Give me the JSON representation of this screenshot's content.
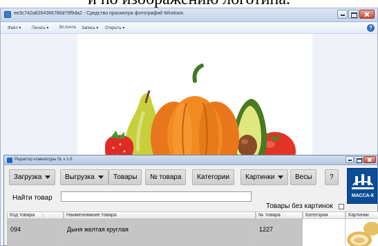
{
  "caption": {
    "text": "и по изображению логотипа."
  },
  "photo_viewer": {
    "title": "ee3c742a8264366786d79f9da2 - Средство просмотра фотографий Windows",
    "menu": [
      "Файл ▾",
      "Печать ▾",
      "Эл.почта",
      "Запись ▾",
      "Открыть ▾"
    ],
    "help_icon": "help-icon"
  },
  "keyboard_editor": {
    "title": "Редактор клавиатуры SL v 1.6",
    "toolbar": {
      "load_label": "Загрузка",
      "unload_label": "Выгрузка",
      "products_label": "Товары",
      "product_no_label": "№ товара",
      "categories_label": "Категории",
      "images_label": "Картинки",
      "scales_label": "Весы",
      "help_label": "?"
    },
    "logo_text": "МАССА-К",
    "search": {
      "label": "Найти товар",
      "value": "",
      "placeholder": ""
    },
    "no_images_label": "Товары без картинок",
    "no_images_checked": false,
    "table": {
      "columns": [
        "Код товара",
        "Наименование товара",
        "№ товара",
        "Категория",
        "Картинки"
      ],
      "rows": [
        {
          "code": "094",
          "name": "Дыня желтая круглая",
          "number": "1227",
          "category": "",
          "image": "melon-image"
        }
      ]
    }
  },
  "colors": {
    "logo_bg": "#0b4d96",
    "selection": "#c5c5c5",
    "titlebar": "#c3d4ea"
  }
}
